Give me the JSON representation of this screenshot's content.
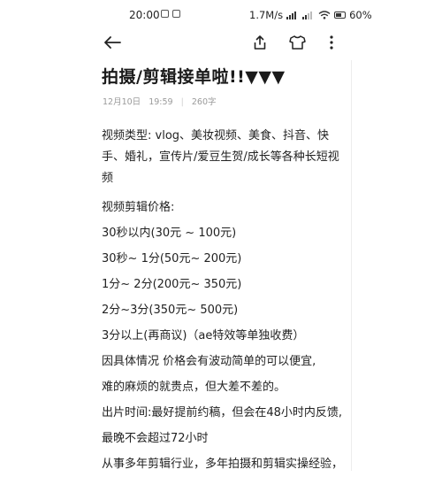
{
  "status": {
    "time": "20:00",
    "network_speed": "1.7M/s",
    "battery": "60%"
  },
  "article": {
    "title": "拍摄/剪辑接单啦!!▼▼▼",
    "date": "12月10日",
    "time": "19:59",
    "word_count": "260字",
    "lines": [
      "视频类型: vlog、美妆视频、美食、抖音、快手、婚礼，宣传片/爱豆生贺/成长等各种长短视频",
      "视频剪辑价格:",
      "30秒以内(30元 ~ 100元)",
      "30秒~ 1分(50元~ 200元)",
      " 1分~ 2分(200元~ 350元)",
      " 2分~3分(350元~ 500元)",
      " 3分以上(再商议)（ae特效等单独收费）",
      "因具体情况 价格会有波动简单的可以便宜,",
      "难的麻烦的就贵点，但大差不差的。",
      "出片时间:最好提前约稿，但会在48小时内反馈,",
      "最晚不会超过72小时",
      "从事多年剪辑行业，多年拍摄和剪辑实操经验，"
    ]
  }
}
